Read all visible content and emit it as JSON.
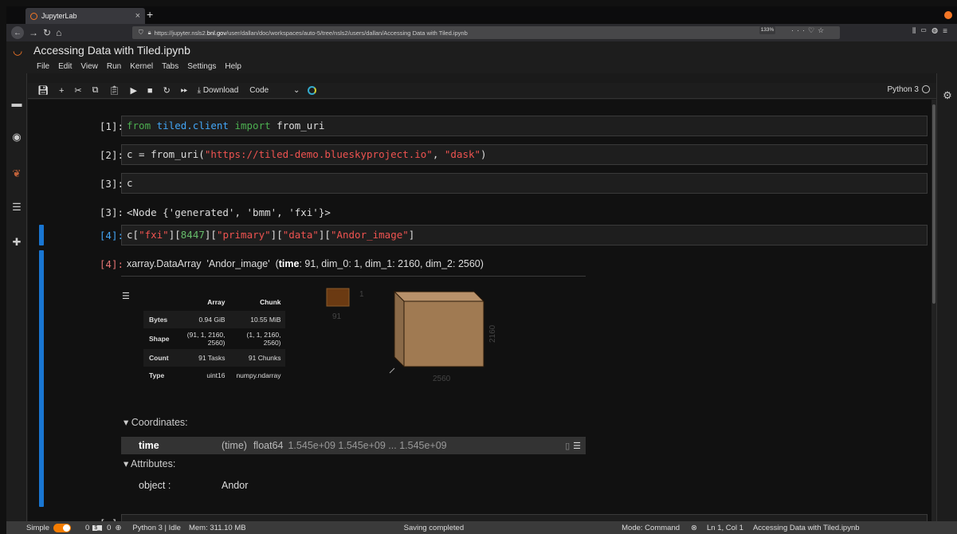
{
  "browser": {
    "tab_title": "JupyterLab",
    "url_prefix": "https://jupyter.nsls2.",
    "url_host": "bnl.gov",
    "url_path": "/user/dallan/doc/workspaces/auto-5/tree/nsls2/users/dallan/Accessing Data with Tiled.ipynb",
    "zoom": "133%"
  },
  "jupyter": {
    "doc_title": "Accessing Data with Tiled.ipynb",
    "menu": [
      "File",
      "Edit",
      "View",
      "Run",
      "Kernel",
      "Tabs",
      "Settings",
      "Help"
    ],
    "toolbar": {
      "download_label": "Download",
      "cell_type": "Code",
      "kernel_name": "Python 3"
    }
  },
  "cells": {
    "c1": {
      "prompt": "[1]:",
      "code_kw": "from",
      "code_mod": "tiled.client",
      "code_kw2": "import",
      "code_rest": "from_uri"
    },
    "c2": {
      "prompt": "[2]:",
      "code_a": "c = from_uri(",
      "code_s1": "\"https://tiled-demo.blueskyproject.io\"",
      "code_b": ", ",
      "code_s2": "\"dask\"",
      "code_c": ")"
    },
    "c3": {
      "prompt": "[3]:",
      "code": "c",
      "out_prompt": "[3]:",
      "out": "<Node {'generated', 'bmm', 'fxi'}>"
    },
    "c4": {
      "prompt": "[4]:",
      "code_parts": [
        "c[",
        "\"fxi\"",
        "][",
        "8447",
        "][",
        "\"primary\"",
        "][",
        "\"data\"",
        "][",
        "\"Andor_image\"",
        "]"
      ],
      "out_prompt": "[4]:",
      "xr_type": "xarray.DataArray",
      "xr_name": "'Andor_image'",
      "dims": [
        {
          "name": "time",
          "size": "91",
          "bold": true
        },
        {
          "name": "dim_0",
          "size": "1"
        },
        {
          "name": "dim_1",
          "size": "2160"
        },
        {
          "name": "dim_2",
          "size": "2560"
        }
      ],
      "table": {
        "headers": [
          "",
          "Array",
          "Chunk"
        ],
        "rows": [
          [
            "Bytes",
            "0.94 GiB",
            "10.55 MiB"
          ],
          [
            "Shape",
            "(91, 1, 2160, 2560)",
            "(1, 1, 2160, 2560)"
          ],
          [
            "Count",
            "91 Tasks",
            "91 Chunks"
          ],
          [
            "Type",
            "uint16",
            "numpy.ndarray"
          ]
        ]
      },
      "chunk_labels": {
        "small_top": "1",
        "small_bottom": "91",
        "cube_side": "2160",
        "cube_bottom": "2560"
      },
      "coordinates_label": "▾ Coordinates:",
      "coord": {
        "name": "time",
        "dims": "(time)",
        "dtype": "float64",
        "preview": "1.545e+09 1.545e+09 ... 1.545e+09"
      },
      "attributes_label": "▾ Attributes:",
      "attr": {
        "key": "object :",
        "value": "Andor"
      }
    },
    "c5": {
      "prompt": "[ ]:"
    }
  },
  "statusbar": {
    "simple": "Simple",
    "terminals": "0",
    "kernels": "0",
    "kernel_status": "Python 3 | Idle",
    "mem": "Mem: 311.10 MB",
    "message": "Saving completed",
    "mode": "Mode: Command",
    "position": "Ln 1, Col 1",
    "file": "Accessing Data with Tiled.ipynb"
  },
  "colors": {
    "accent": "#f37626",
    "active": "#1976d2",
    "keyword": "#4caf50",
    "string": "#ef5350",
    "cube": "#a07a52"
  }
}
